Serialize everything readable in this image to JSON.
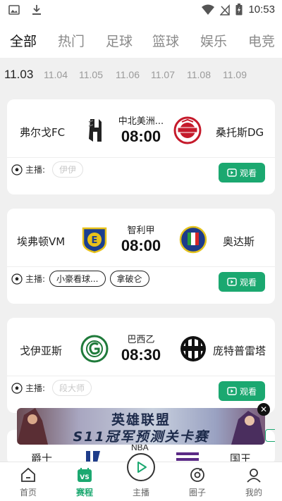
{
  "status_bar": {
    "time": "10:53"
  },
  "category_tabs": [
    {
      "label": "全部",
      "active": true
    },
    {
      "label": "热门",
      "active": false
    },
    {
      "label": "足球",
      "active": false
    },
    {
      "label": "篮球",
      "active": false
    },
    {
      "label": "娱乐",
      "active": false
    },
    {
      "label": "电竞",
      "active": false
    }
  ],
  "dates": [
    {
      "label": "11.03",
      "active": true
    },
    {
      "label": "11.04"
    },
    {
      "label": "11.05"
    },
    {
      "label": "11.06"
    },
    {
      "label": "11.07"
    },
    {
      "label": "11.08"
    },
    {
      "label": "11.09"
    }
  ],
  "matches": [
    {
      "home_team": "弗尔戈FC",
      "league": "中北美洲...",
      "time": "08:00",
      "away_team": "桑托斯DG",
      "host_label": "主播:",
      "hosts": [
        {
          "name": "伊伊",
          "placeholder": true
        }
      ],
      "watch_label": "观看"
    },
    {
      "home_team": "埃弗顿VM",
      "league": "智利甲",
      "time": "08:00",
      "away_team": "奥达斯",
      "host_label": "主播:",
      "hosts": [
        {
          "name": "小豪看球..."
        },
        {
          "name": "拿破仑"
        }
      ],
      "watch_label": "观看"
    },
    {
      "home_team": "戈伊亚斯",
      "league": "巴西乙",
      "time": "08:30",
      "away_team": "庞特普雷塔",
      "host_label": "主播:",
      "hosts": [
        {
          "name": "段大师",
          "placeholder": true
        }
      ],
      "watch_label": "观看"
    }
  ],
  "peek_card": {
    "home_team": "爵士",
    "league": "NBA",
    "away_team": "国王"
  },
  "banner": {
    "title": "英雄联盟",
    "subtitle": "S11冠军预测关卡赛",
    "close": "✕"
  },
  "bottom_nav": [
    {
      "label": "首页",
      "icon": "home-icon"
    },
    {
      "label": "赛程",
      "icon": "schedule-icon",
      "active": true
    },
    {
      "label": "主播",
      "icon": "play-icon"
    },
    {
      "label": "圈子",
      "icon": "circle-icon"
    },
    {
      "label": "我的",
      "icon": "profile-icon"
    }
  ],
  "colors": {
    "accent": "#1ba870"
  }
}
